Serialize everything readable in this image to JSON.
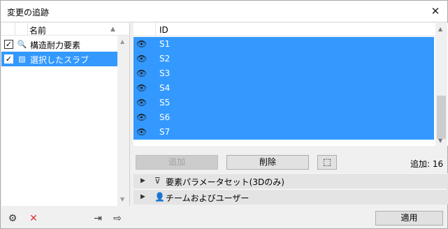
{
  "window": {
    "title": "変更の追跡",
    "close_glyph": "✕"
  },
  "left_panel": {
    "column_header": "名前",
    "sort_glyph": "▲",
    "items": [
      {
        "label": "構造耐力要素",
        "checked": true,
        "selected": false,
        "icon": "structural-search-icon",
        "check_glyph": "✓",
        "icon_glyph": "🔍"
      },
      {
        "label": "選択したスラブ",
        "checked": true,
        "selected": true,
        "icon": "slab-icon",
        "check_glyph": "✓",
        "icon_glyph": "▨"
      }
    ],
    "toolbar": {
      "new_glyph": "⚙",
      "delete_glyph": "✕",
      "import_glyph": "⇥",
      "export_glyph": "⇨"
    }
  },
  "right_panel": {
    "column_header": "ID",
    "eye_glyph": "👁",
    "rows": [
      "S1",
      "S2",
      "S3",
      "S4",
      "S5",
      "S6",
      "S7"
    ],
    "add_button": "追加",
    "delete_button": "削除",
    "fit_glyph": "⬚",
    "added_count": "追加: 16",
    "sections": [
      {
        "label": "要素パラメータセット(3Dのみ)",
        "icon": "filter-icon",
        "icon_glyph": "⊽",
        "tri": "▶"
      },
      {
        "label": "チームおよびユーザー",
        "icon": "user-icon",
        "icon_glyph": "👤",
        "tri": "▶"
      }
    ],
    "apply_button": "適用"
  },
  "colors": {
    "selection": "#3399ff",
    "delete_icon": "#e03030"
  }
}
